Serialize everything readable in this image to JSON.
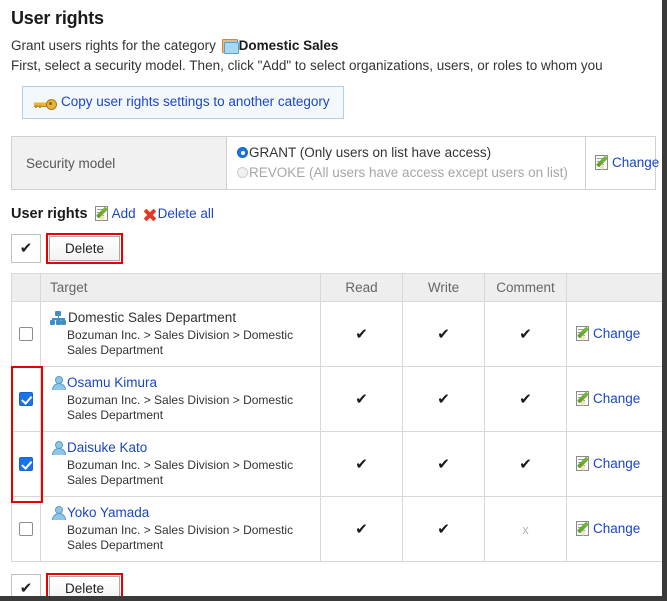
{
  "page": {
    "title": "User rights",
    "description_prefix": "Grant users rights for the category ",
    "category_name": "Domestic Sales",
    "description_line2": "First, select a security model. Then, click \"Add\" to select organizations, users, or roles to whom you",
    "copy_button_label": "Copy user rights settings to another category"
  },
  "security_model": {
    "label": "Security model",
    "options": [
      {
        "label": "GRANT (Only users on list have access)",
        "selected": true,
        "disabled": false
      },
      {
        "label": "REVOKE (All users have access except users on list)",
        "selected": false,
        "disabled": true
      }
    ],
    "change_label": "Change"
  },
  "user_rights": {
    "heading": "User rights",
    "add_label": "Add",
    "delete_all_label": "Delete all",
    "select_all_check": "✔",
    "delete_button_label": "Delete",
    "columns": [
      "",
      "Target",
      "Read",
      "Write",
      "Comment",
      ""
    ],
    "rows": [
      {
        "checked": false,
        "icon": "org-icon",
        "name": "Domestic Sales Department",
        "is_link": false,
        "path": "Bozuman Inc. > Sales Division > Domestic Sales Department",
        "read": "✔",
        "write": "✔",
        "comment": "✔",
        "read_on": true,
        "write_on": true,
        "comment_on": true,
        "action_label": "Change"
      },
      {
        "checked": true,
        "icon": "user-icon",
        "name": "Osamu Kimura",
        "is_link": true,
        "path": "Bozuman Inc. > Sales Division > Domestic Sales Department",
        "read": "✔",
        "write": "✔",
        "comment": "✔",
        "read_on": true,
        "write_on": true,
        "comment_on": true,
        "action_label": "Change"
      },
      {
        "checked": true,
        "icon": "user-icon",
        "name": "Daisuke Kato",
        "is_link": true,
        "path": "Bozuman Inc. > Sales Division > Domestic Sales Department",
        "read": "✔",
        "write": "✔",
        "comment": "✔",
        "read_on": true,
        "write_on": true,
        "comment_on": true,
        "action_label": "Change"
      },
      {
        "checked": false,
        "icon": "user-icon",
        "name": "Yoko Yamada",
        "is_link": true,
        "path": "Bozuman Inc. > Sales Division > Domestic Sales Department",
        "read": "✔",
        "write": "✔",
        "comment": "x",
        "read_on": true,
        "write_on": true,
        "comment_on": false,
        "action_label": "Change"
      }
    ]
  },
  "colors": {
    "link": "#1b45c8",
    "highlight": "#e60000",
    "radio_selected": "#1a73e8",
    "checkbox_checked": "#1a73e8",
    "header_bg": "#eeeeee"
  }
}
